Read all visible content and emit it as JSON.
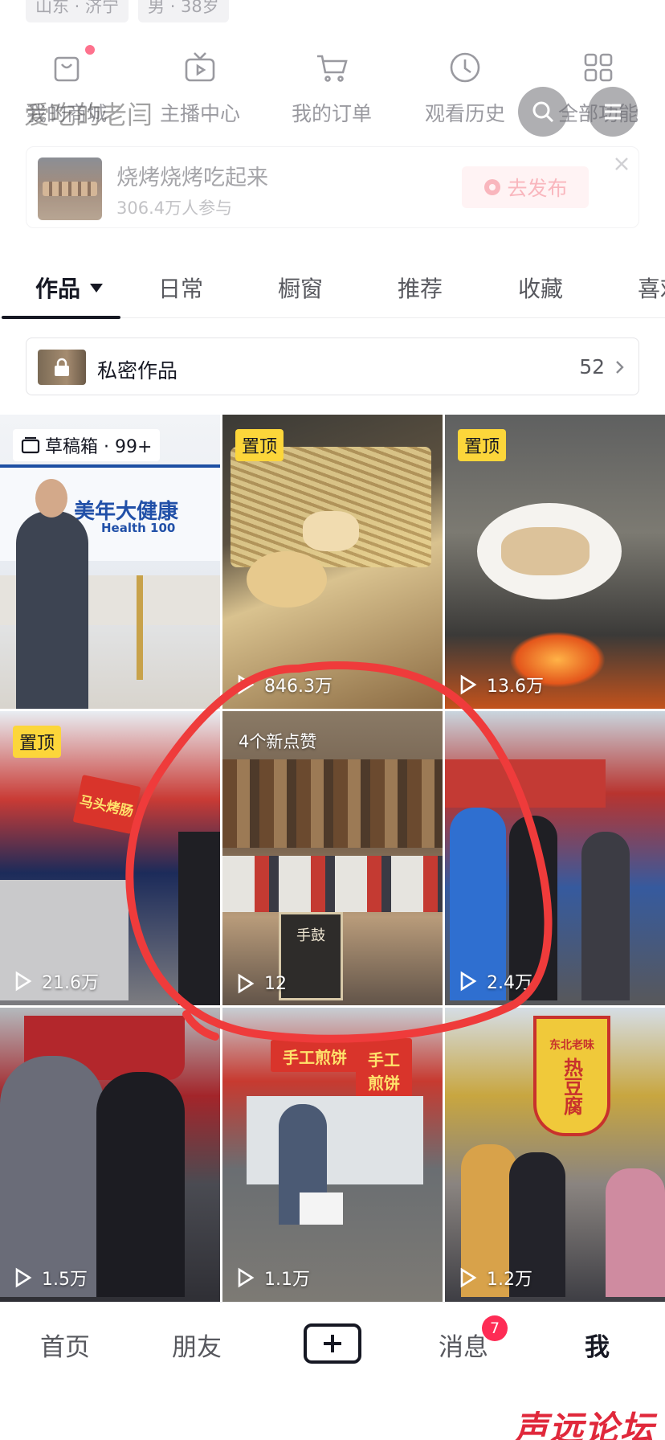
{
  "profile": {
    "location_tag": "山东 · 济宁",
    "gender_age_tag": "男 · 38岁"
  },
  "tools": [
    {
      "label": "我的商城",
      "icon": "shopping-bag-icon"
    },
    {
      "label": "主播中心",
      "icon": "tv-icon"
    },
    {
      "label": "我的订单",
      "icon": "cart-icon"
    },
    {
      "label": "观看历史",
      "icon": "clock-icon"
    },
    {
      "label": "全部功能",
      "icon": "grid-icon"
    }
  ],
  "header": {
    "ghost_title": "爱吃的老闫",
    "search_icon": "search-icon",
    "menu_icon": "menu-icon"
  },
  "activity": {
    "title": "烧烤烧烤吃起来",
    "participants": "306.4万人参与",
    "publish_label": "去发布"
  },
  "tabs": [
    {
      "label": "作品",
      "active": true
    },
    {
      "label": "日常"
    },
    {
      "label": "橱窗"
    },
    {
      "label": "推荐"
    },
    {
      "label": "收藏"
    },
    {
      "label": "喜欢"
    }
  ],
  "private_works": {
    "label": "私密作品",
    "count": "52"
  },
  "videos": [
    {
      "badge_type": "draft",
      "badge": "草稿箱 · 99+",
      "plays": "",
      "sign": "美年大健康",
      "sign_sub": "Health 100"
    },
    {
      "badge_type": "pin",
      "badge": "置顶",
      "plays": "846.3万"
    },
    {
      "badge_type": "pin",
      "badge": "置顶",
      "plays": "13.6万"
    },
    {
      "badge_type": "pin",
      "badge": "置顶",
      "plays": "21.6万",
      "sign": "马头烤肠"
    },
    {
      "badge_type": "likes",
      "badge": "4个新点赞",
      "plays": "12",
      "sign": "手鼓"
    },
    {
      "badge_type": "none",
      "badge": "",
      "plays": "2.4万"
    },
    {
      "badge_type": "none",
      "badge": "",
      "plays": "1.5万"
    },
    {
      "badge_type": "none",
      "badge": "",
      "plays": "1.1万",
      "sign": "手工煎饼",
      "sign2": "手工 煎饼"
    },
    {
      "badge_type": "none",
      "badge": "",
      "plays": "1.2万",
      "sign": "东北老味",
      "sign2": "热豆腐"
    }
  ],
  "bottom_nav": {
    "home": "首页",
    "friends": "朋友",
    "messages": "消息",
    "messages_badge": "7",
    "me": "我"
  },
  "watermark": "声远论坛",
  "colors": {
    "pin_badge": "#fcd63a",
    "annotation_red": "#ef3b3b",
    "message_badge": "#fe2c55",
    "watermark": "#e0283b"
  }
}
